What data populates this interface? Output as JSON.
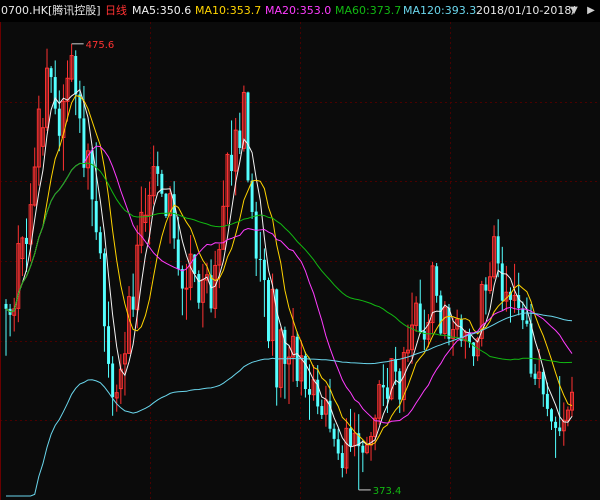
{
  "header": {
    "code": "0700.HK",
    "name": "[腾讯控股]",
    "period": "日线",
    "ma5": "MA5:350.6",
    "ma10": "MA10:353.7",
    "ma20": "MA20:353.0",
    "ma60": "MA60:373.7",
    "ma120": "MA120:393.3",
    "range": "2018/01/10-2018/",
    "dropdown_icon": "chevron-down-icon",
    "nav_icon": "chevron-right-icon"
  },
  "colors": {
    "up": "#ff3232",
    "down": "#54ffff",
    "bg": "#0b0b0b",
    "grid": "#4a0000",
    "ma5": "#f3f3f3",
    "ma10": "#ffd400",
    "ma20": "#ff3cff",
    "ma60": "#12b812",
    "ma120": "#6ad6ec"
  },
  "chart_data": {
    "type": "candlestick",
    "ylim": [
      364,
      480
    ],
    "high_label": "475.6",
    "low_label": "373.4",
    "candles": [
      [
        411.4,
        412.6,
        398.6,
        410.2
      ],
      [
        410.2,
        411.4,
        403.4,
        408.7
      ],
      [
        408.6,
        412.9,
        404.6,
        410.2
      ],
      [
        410.3,
        430.8,
        406.9,
        426.3
      ],
      [
        422.6,
        428.1,
        418.3,
        427.7
      ],
      [
        427.7,
        432.5,
        419.3,
        426.2
      ],
      [
        426.2,
        441.2,
        421.9,
        435.9
      ],
      [
        435.8,
        450.0,
        435.4,
        445.2
      ],
      [
        445.2,
        462.8,
        440.6,
        459.5
      ],
      [
        450.3,
        457.3,
        448.0,
        454.9
      ],
      [
        455.0,
        474.4,
        454.1,
        469.6
      ],
      [
        469.6,
        470.1,
        463.5,
        467.4
      ],
      [
        467.4,
        471.5,
        458.2,
        459.6
      ],
      [
        459.6,
        464.1,
        449.1,
        452.9
      ],
      [
        452.5,
        465.6,
        444.3,
        461.4
      ],
      [
        461.4,
        471.5,
        456.4,
        467.1
      ],
      [
        466.9,
        475.6,
        466.2,
        472.7
      ],
      [
        472.6,
        474.0,
        458.0,
        463.1
      ],
      [
        463.1,
        466.5,
        453.6,
        457.2
      ],
      [
        457.2,
        465.2,
        442.7,
        445.0
      ],
      [
        445.0,
        451.0,
        439.6,
        449.2
      ],
      [
        449.3,
        450.1,
        430.6,
        437.2
      ],
      [
        436.8,
        451.3,
        427.2,
        429.1
      ],
      [
        429.1,
        430.5,
        422.5,
        423.9
      ],
      [
        423.9,
        425.1,
        399.6,
        405.9
      ],
      [
        405.9,
        412.0,
        393.2,
        396.6
      ],
      [
        396.7,
        398.5,
        383.8,
        388.4
      ],
      [
        388.2,
        391.5,
        384.8,
        389.5
      ],
      [
        390.5,
        399.0,
        386.7,
        395.3
      ],
      [
        396.6,
        404.5,
        388.8,
        399.1
      ],
      [
        399.2,
        415.8,
        399.1,
        413.2
      ],
      [
        413.2,
        418.9,
        408.2,
        410.0
      ],
      [
        410.0,
        430.8,
        405.4,
        425.9
      ],
      [
        425.9,
        440.4,
        423.9,
        434.0
      ],
      [
        431.5,
        440.0,
        429.2,
        433.3
      ],
      [
        433.2,
        441.6,
        426.0,
        438.2
      ],
      [
        438.1,
        450.5,
        436.0,
        445.3
      ],
      [
        445.4,
        449.0,
        440.5,
        443.5
      ],
      [
        443.5,
        444.5,
        437.8,
        438.6
      ],
      [
        438.6,
        438.8,
        432.6,
        433.1
      ],
      [
        433.2,
        440.5,
        426.3,
        438.6
      ],
      [
        438.5,
        441.7,
        425.0,
        427.6
      ],
      [
        427.3,
        432.9,
        418.4,
        420.0
      ],
      [
        420.0,
        420.9,
        408.6,
        415.2
      ],
      [
        415.2,
        421.3,
        407.5,
        415.3
      ],
      [
        415.5,
        428.4,
        412.3,
        423.7
      ],
      [
        423.6,
        423.7,
        416.8,
        418.8
      ],
      [
        418.8,
        419.7,
        410.2,
        411.7
      ],
      [
        411.8,
        421.3,
        405.6,
        417.4
      ],
      [
        417.3,
        421.6,
        414.0,
        418.6
      ],
      [
        418.5,
        422.4,
        409.3,
        410.3
      ],
      [
        410.3,
        424.5,
        407.9,
        420.9
      ],
      [
        421.0,
        426.2,
        415.3,
        424.8
      ],
      [
        424.9,
        441.9,
        424.8,
        435.5
      ],
      [
        435.5,
        448.8,
        431.1,
        448.3
      ],
      [
        448.2,
        456.7,
        440.6,
        444.2
      ],
      [
        444.2,
        457.3,
        438.2,
        454.3
      ],
      [
        454.2,
        458.6,
        448.4,
        449.9
      ],
      [
        449.8,
        465.3,
        449.0,
        463.6
      ],
      [
        463.6,
        463.8,
        441.4,
        441.9
      ],
      [
        441.8,
        443.6,
        432.4,
        434.1
      ],
      [
        434.2,
        436.6,
        418.3,
        422.6
      ],
      [
        422.5,
        429.2,
        416.9,
        422.4
      ],
      [
        422.3,
        425.1,
        408.2,
        417.3
      ],
      [
        417.3,
        417.9,
        400.5,
        402.2
      ],
      [
        402.4,
        418.9,
        398.6,
        415.0
      ],
      [
        415.0,
        415.2,
        386.3,
        390.8
      ],
      [
        390.8,
        405.5,
        388.3,
        405.0
      ],
      [
        405.0,
        405.8,
        388.0,
        396.6
      ],
      [
        396.6,
        400.9,
        386.7,
        398.3
      ],
      [
        398.3,
        410.4,
        392.2,
        403.4
      ],
      [
        403.3,
        404.6,
        390.9,
        392.4
      ],
      [
        392.4,
        402.4,
        388.8,
        398.6
      ],
      [
        398.6,
        399.6,
        388.3,
        390.4
      ],
      [
        390.4,
        396.5,
        382.8,
        389.0
      ],
      [
        389.0,
        396.3,
        387.5,
        392.7
      ],
      [
        392.7,
        396.3,
        384.2,
        386.1
      ],
      [
        386.2,
        387.8,
        383.0,
        384.0
      ],
      [
        384.2,
        391.2,
        381.1,
        387.7
      ],
      [
        387.5,
        392.9,
        379.7,
        380.6
      ],
      [
        380.6,
        381.9,
        376.2,
        378.1
      ],
      [
        378.0,
        380.6,
        372.9,
        374.5
      ],
      [
        374.6,
        376.5,
        368.6,
        370.9
      ],
      [
        370.9,
        383.2,
        369.5,
        380.7
      ],
      [
        380.7,
        385.5,
        374.9,
        376.3
      ],
      [
        376.4,
        384.6,
        373.8,
        379.5
      ],
      [
        379.5,
        384.2,
        365.5,
        376.3
      ],
      [
        376.4,
        377.8,
        369.9,
        374.7
      ],
      [
        374.7,
        378.6,
        374.3,
        376.6
      ],
      [
        376.6,
        379.8,
        372.7,
        378.7
      ],
      [
        378.7,
        384.1,
        375.3,
        383.2
      ],
      [
        383.2,
        392.6,
        381.6,
        391.5
      ],
      [
        391.4,
        396.5,
        386.2,
        390.8
      ],
      [
        390.8,
        395.6,
        384.5,
        388.0
      ],
      [
        388.0,
        398.0,
        387.6,
        397.9
      ],
      [
        397.8,
        400.8,
        391.4,
        394.7
      ],
      [
        394.8,
        395.5,
        384.5,
        387.8
      ],
      [
        387.8,
        400.8,
        384.8,
        399.4
      ],
      [
        399.3,
        406.3,
        397.1,
        400.0
      ],
      [
        400.1,
        414.2,
        396.6,
        406.2
      ],
      [
        406.1,
        413.3,
        404.5,
        411.6
      ],
      [
        411.5,
        417.4,
        404.0,
        404.6
      ],
      [
        404.7,
        410.0,
        400.0,
        402.6
      ],
      [
        402.7,
        408.9,
        400.7,
        406.8
      ],
      [
        406.8,
        421.8,
        404.0,
        420.8
      ],
      [
        420.7,
        421.5,
        411.7,
        413.4
      ],
      [
        413.5,
        414.7,
        403.6,
        404.1
      ],
      [
        404.1,
        412.1,
        402.8,
        410.5
      ],
      [
        410.5,
        411.4,
        401.2,
        402.8
      ],
      [
        402.9,
        407.9,
        398.6,
        405.1
      ],
      [
        405.2,
        410.0,
        403.3,
        407.6
      ],
      [
        407.6,
        408.8,
        400.8,
        402.3
      ],
      [
        402.3,
        405.0,
        397.9,
        404.5
      ],
      [
        404.4,
        405.3,
        400.6,
        401.9
      ],
      [
        401.9,
        402.0,
        396.1,
        398.5
      ],
      [
        398.6,
        403.3,
        397.3,
        402.8
      ],
      [
        402.9,
        417.1,
        400.9,
        416.2
      ],
      [
        416.2,
        418.0,
        408.8,
        414.7
      ],
      [
        414.7,
        421.7,
        413.9,
        418.1
      ],
      [
        418.1,
        430.8,
        417.5,
        428.0
      ],
      [
        428.1,
        432.3,
        418.0,
        421.4
      ],
      [
        421.4,
        425.5,
        409.7,
        412.2
      ],
      [
        412.1,
        420.8,
        409.5,
        414.3
      ],
      [
        414.4,
        415.5,
        406.8,
        412.4
      ],
      [
        412.3,
        421.3,
        409.2,
        413.5
      ],
      [
        413.6,
        419.1,
        408.6,
        410.4
      ],
      [
        410.3,
        412.0,
        405.2,
        407.4
      ],
      [
        407.3,
        413.0,
        405.8,
        406.5
      ],
      [
        406.6,
        411.4,
        393.3,
        394.2
      ],
      [
        394.2,
        396.6,
        391.4,
        392.9
      ],
      [
        393.0,
        400.3,
        390.6,
        394.6
      ],
      [
        394.6,
        395.3,
        386.0,
        389.1
      ],
      [
        389.2,
        392.0,
        383.7,
        385.5
      ],
      [
        385.4,
        385.7,
        380.3,
        382.4
      ],
      [
        382.3,
        383.6,
        373.4,
        380.8
      ],
      [
        380.9,
        393.6,
        378.8,
        380.0
      ],
      [
        380.1,
        387.1,
        376.4,
        382.7
      ],
      [
        382.6,
        386.1,
        381.2,
        385.2
      ],
      [
        385.2,
        393.4,
        383.5,
        389.6
      ]
    ]
  }
}
